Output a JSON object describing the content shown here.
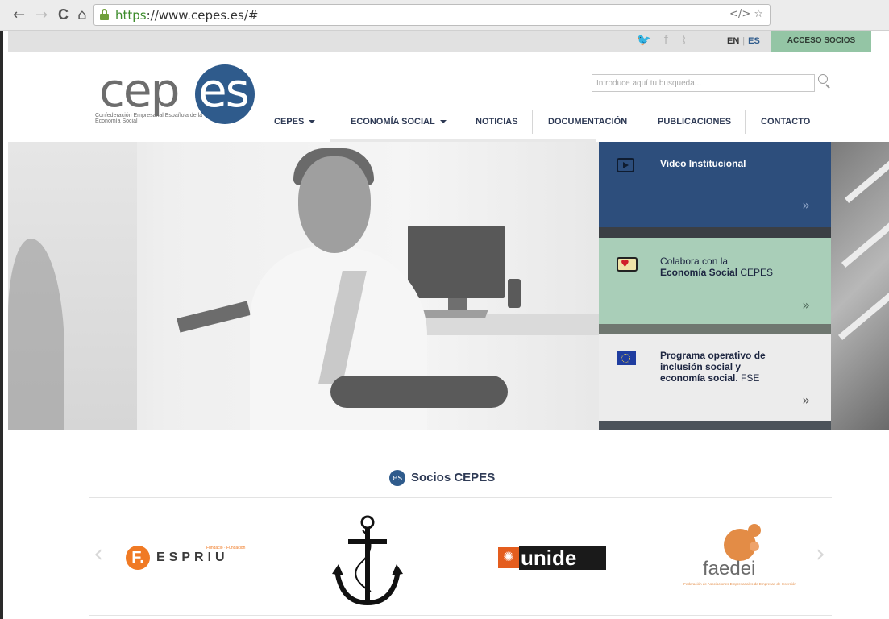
{
  "browser": {
    "back": "←",
    "forward": "→",
    "reload": "C",
    "home": "⌂",
    "url_scheme": "https",
    "url_rest": "://www.cepes.es/#",
    "url_icons": "</> ☆"
  },
  "topbar": {
    "social_icons": [
      "twitter-icon",
      "facebook-icon",
      "rss-icon"
    ],
    "social_glyphs": "🐦 f ⌇",
    "lang_en": "EN",
    "lang_es": "ES",
    "acceso": "ACCESO SOCIOS"
  },
  "logo": {
    "ce": "cep",
    "es": "es",
    "subtitle": "Confederación Empresarial Española de la Economía Social",
    "brand_color": "#2f5b8c"
  },
  "search": {
    "placeholder": "Introduce aquí tu busqueda..."
  },
  "menu": {
    "items": [
      {
        "label": "CEPES",
        "dropdown": true
      },
      {
        "label": "ECONOMÍA SOCIAL",
        "dropdown": true
      },
      {
        "label": "NOTICIAS",
        "dropdown": false
      },
      {
        "label": "DOCUMENTACIÓN",
        "dropdown": false
      },
      {
        "label": "PUBLICACIONES",
        "dropdown": false
      },
      {
        "label": "CONTACTO",
        "dropdown": false
      }
    ]
  },
  "panels": {
    "video": {
      "title": "Video Institucional",
      "arrows": "»"
    },
    "colabora": {
      "title_line1": "Colabora con la",
      "title_line2_bold": "Economía Social",
      "title_line2_rest": " CEPES",
      "arrows": "»"
    },
    "programa": {
      "title_line1": "Programa operativo de",
      "title_line2": "inclusión social y",
      "title_line3_bold": "economía social.",
      "title_line3_rest": " FSE",
      "arrows": "»"
    }
  },
  "socios": {
    "icon_text": "es",
    "title": "Socios CEPES",
    "prev": "‹",
    "next": "›",
    "logos": {
      "espriu": {
        "mark": "F.",
        "name": "ESPRIU",
        "small": "Fundació · Fundación"
      },
      "unide": {
        "mark": "✺",
        "name": "unide"
      },
      "faedei": {
        "name": "faedei",
        "sub": "Federación de Asociaciones Empresariales de Empresas de Inserción"
      }
    }
  }
}
